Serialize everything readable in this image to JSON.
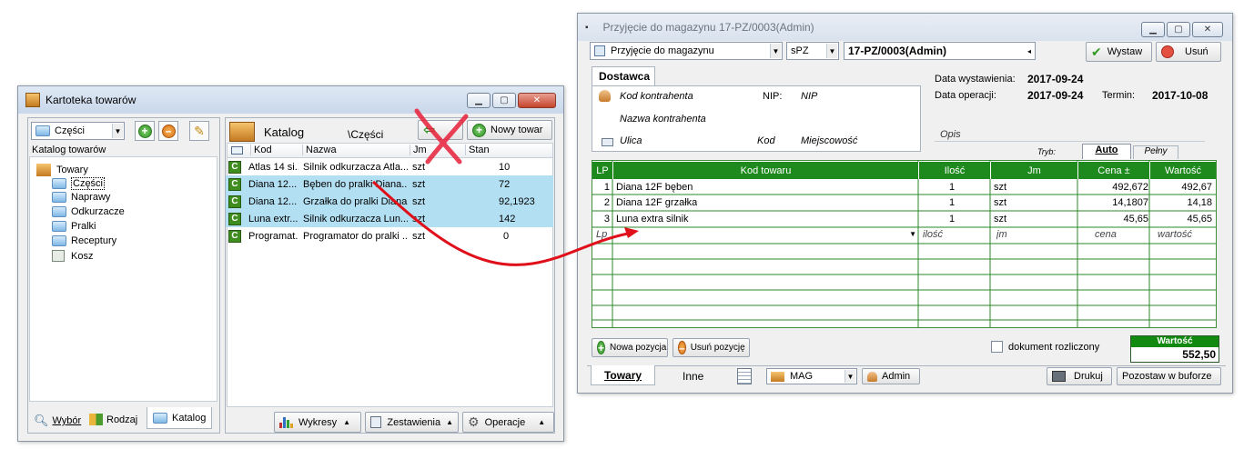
{
  "left_window": {
    "title": "Kartoteka towarów",
    "category_combo": "Części",
    "catalog_label": "Katalog towarów",
    "tree": {
      "root": "Towary",
      "items": [
        "Części",
        "Naprawy",
        "Odkurzacze",
        "Pralki",
        "Receptury",
        "Kosz"
      ]
    },
    "panel_title": "Katalog",
    "path": "\\Części",
    "new_item": "Nowy towar",
    "columns": [
      "Kod",
      "Nazwa",
      "Jm",
      "Stan"
    ],
    "rows": [
      {
        "kod": "Atlas 14 si...",
        "nazwa": "Silnik odkurzacza Atla...",
        "jm": "szt",
        "stan": "10"
      },
      {
        "kod": "Diana 12...",
        "nazwa": "Bęben do pralki Diana...",
        "jm": "szt",
        "stan": "72"
      },
      {
        "kod": "Diana 12...",
        "nazwa": "Grzałka do pralki Diana...",
        "jm": "szt",
        "stan": "92,1923"
      },
      {
        "kod": "Luna extr...",
        "nazwa": "Silnik odkurzacza Lun...",
        "jm": "szt",
        "stan": "142"
      },
      {
        "kod": "Programat...",
        "nazwa": "Programator do pralki ...",
        "jm": "szt",
        "stan": "0"
      }
    ],
    "bottom_tabs": [
      "Wybór",
      "Rodzaj",
      "Katalog"
    ],
    "bottom_buttons": [
      "Wykresy",
      "Zestawienia",
      "Operacje"
    ]
  },
  "right_window": {
    "title": "Przyjęcie do magazynu 17-PZ/0003(Admin)",
    "doc_type": "Przyjęcie do magazynu",
    "series": "sPZ",
    "doc_number": "17-PZ/0003(Admin)",
    "issue_button": "Wystaw",
    "delete_button": "Usuń",
    "supplier_tab": "Dostawca",
    "contractor_code": "Kod kontrahenta",
    "nip_label": "NIP:",
    "nip_value": "NIP",
    "contractor_name": "Nazwa kontrahenta",
    "street": "Ulica",
    "postal": "Kod",
    "city": "Miejscowość",
    "issue_date_label": "Data wystawienia:",
    "issue_date": "2017-09-24",
    "op_date_label": "Data operacji:",
    "op_date": "2017-09-24",
    "due_label": "Termin:",
    "due_date": "2017-10-08",
    "desc_placeholder": "Opis",
    "mode_label": "Tryb:",
    "mode_tabs": [
      "Auto",
      "Pełny"
    ],
    "grid_headers": [
      "LP",
      "Kod towaru",
      "Ilość",
      "Jm",
      "Cena ±",
      "Wartość"
    ],
    "grid_rows": [
      {
        "lp": "1",
        "kod": "Diana 12F bęben",
        "ilosc": "1",
        "jm": "szt",
        "cena": "492,672",
        "wartosc": "492,67"
      },
      {
        "lp": "2",
        "kod": "Diana 12F grzałka",
        "ilosc": "1",
        "jm": "szt",
        "cena": "14,1807",
        "wartosc": "14,18"
      },
      {
        "lp": "3",
        "kod": "Luna extra silnik",
        "ilosc": "1",
        "jm": "szt",
        "cena": "45,65",
        "wartosc": "45,65"
      }
    ],
    "new_row": {
      "lp": "Lp",
      "ilosc": "ilość",
      "jm": "jm",
      "cena": "cena",
      "wartosc": "wartość"
    },
    "add_position": "Nowa pozycja",
    "remove_position": "Usuń pozycję",
    "settled_label": "dokument rozliczony",
    "total_label": "Wartość",
    "total_value": "552,50",
    "bottom_tabs": [
      "Towary",
      "Inne"
    ],
    "warehouse": "MAG",
    "user": "Admin",
    "print_button": "Drukuj",
    "buffer_button": "Pozostaw w buforze"
  }
}
